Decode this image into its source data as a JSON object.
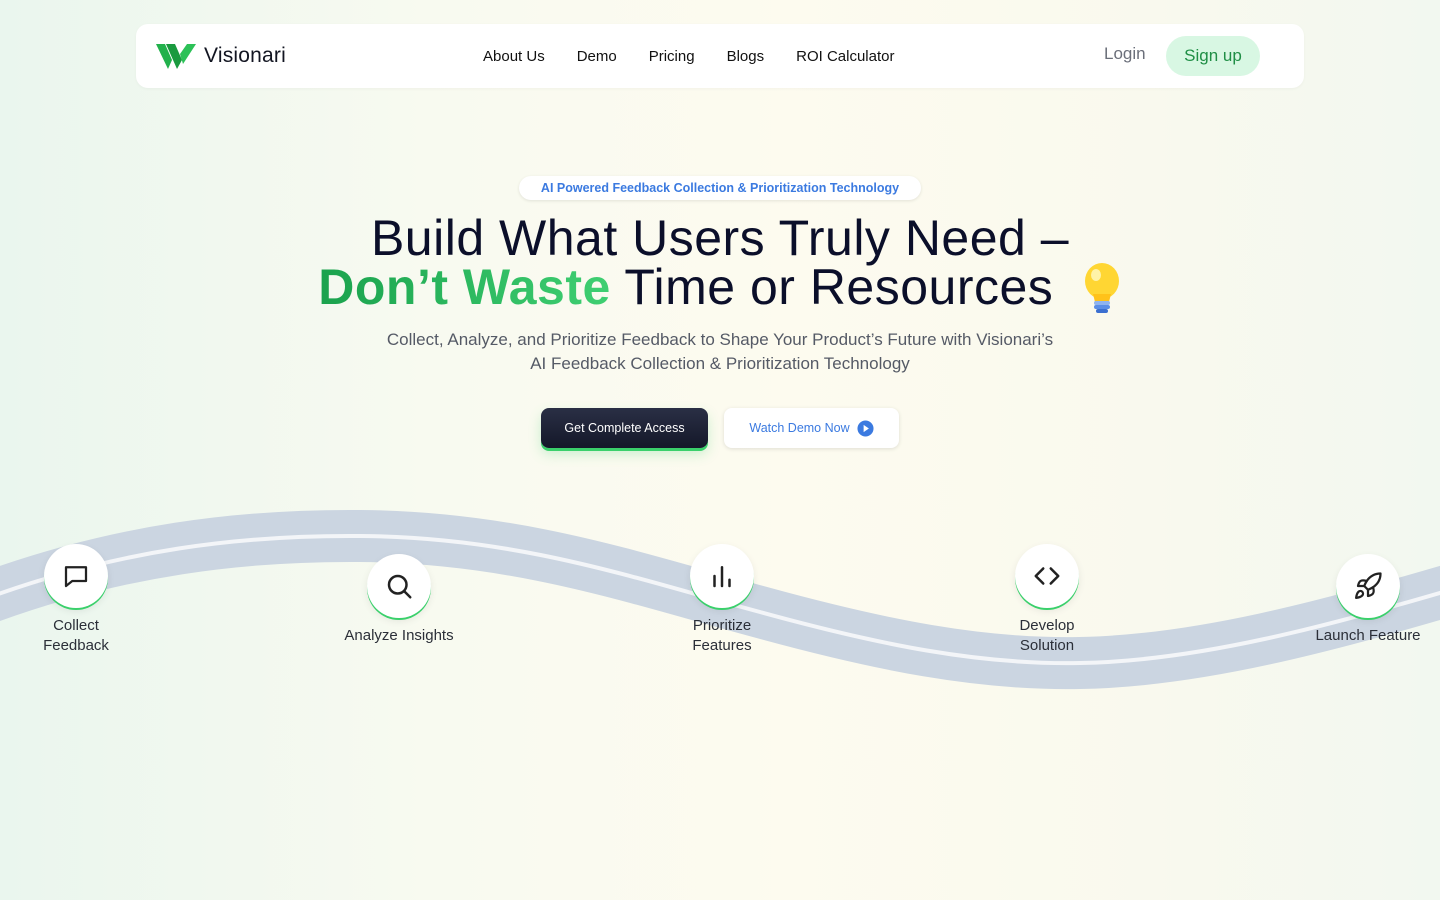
{
  "brand": {
    "name": "Visionari",
    "logo_icon": "visionari-logo-icon",
    "accent": "#22b14c"
  },
  "nav": {
    "items": [
      "About Us",
      "Demo",
      "Pricing",
      "Blogs",
      "ROI Calculator"
    ],
    "login": "Login",
    "signup": "Sign up"
  },
  "hero": {
    "badge": "AI Powered Feedback Collection & Prioritization Technology",
    "title_line1": "Build What Users Truly Need –",
    "title_highlight": "Don’t Waste",
    "title_line2_rest": "Time or Resources",
    "title_icon": "lightbulb-icon",
    "subtitle": "Collect, Analyze, and Prioritize Feedback to Shape Your Product’s Future with Visionari’s AI Feedback Collection & Prioritization Technology",
    "primary_cta": "Get Complete Access",
    "secondary_cta": "Watch Demo Now",
    "secondary_icon": "play-icon"
  },
  "steps": [
    {
      "label": "Collect Feedback",
      "icon": "chat-icon"
    },
    {
      "label": "Analyze Insights",
      "icon": "search-icon"
    },
    {
      "label": "Prioritize Features",
      "icon": "bar-chart-icon"
    },
    {
      "label": "Develop Solution",
      "icon": "code-icon"
    },
    {
      "label": "Launch Feature",
      "icon": "rocket-icon"
    }
  ]
}
